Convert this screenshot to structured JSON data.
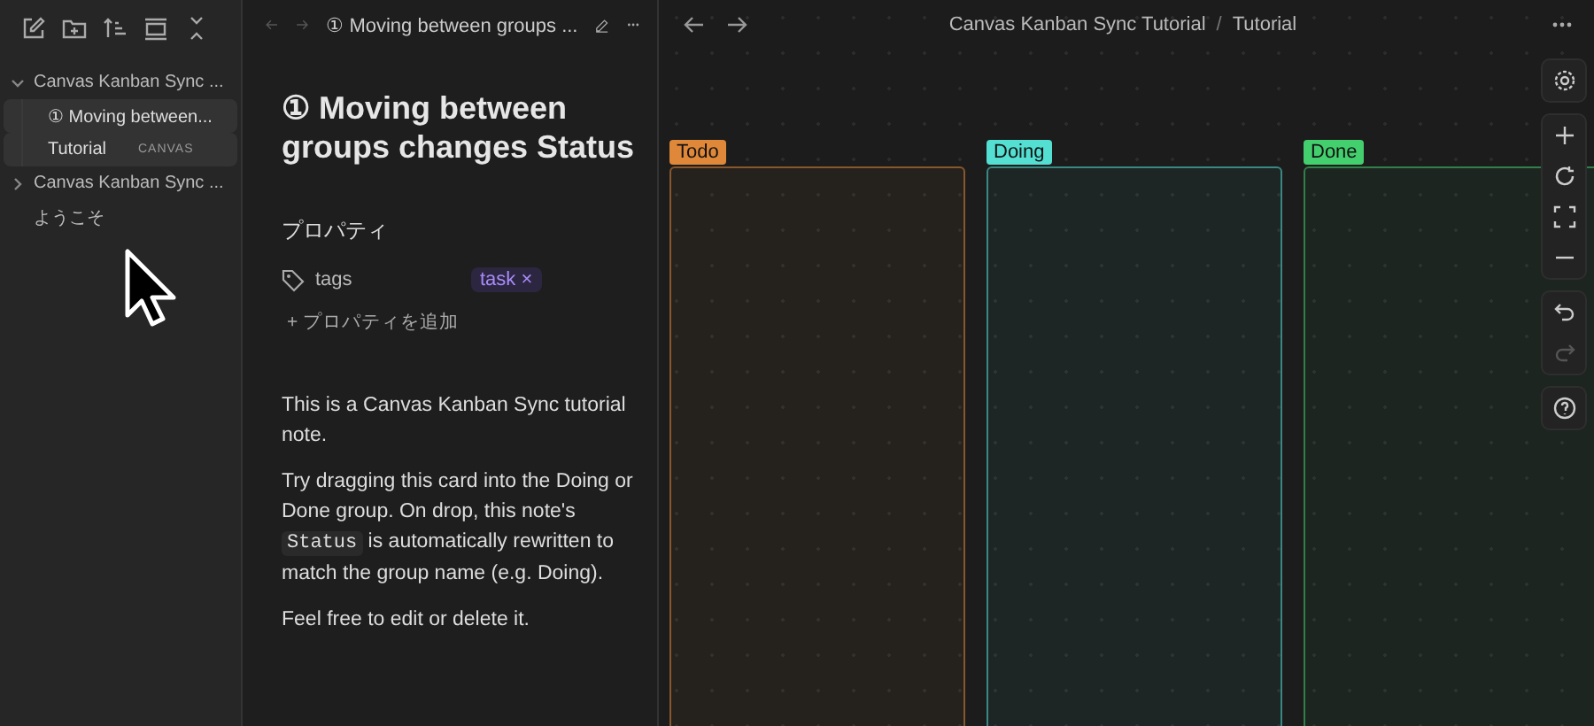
{
  "sidebar": {
    "tree": [
      {
        "label": "Canvas Kanban Sync ...",
        "expanded": true,
        "selected": false,
        "children": [
          {
            "label": "Moving between...",
            "icon": "①",
            "selected": true
          },
          {
            "label": "Tutorial",
            "badge": "CANVAS",
            "selected": true
          }
        ]
      },
      {
        "label": "Canvas Kanban Sync ...",
        "expanded": false,
        "selected": false
      },
      {
        "label": "ようこそ",
        "selected": false
      }
    ]
  },
  "note": {
    "tab_title": "① Moving between groups ...",
    "title": "① Moving between groups changes Status",
    "properties_heading": "プロパティ",
    "properties": [
      {
        "key": "tags",
        "values": [
          "task"
        ],
        "remove": "×"
      }
    ],
    "add_property": "+ プロパティを追加",
    "paragraphs": [
      [
        {
          "text": "This is a Canvas Kanban Sync tutorial note."
        }
      ],
      [
        {
          "text": "Try dragging this card into the Doing or Done group. On drop, this note's "
        },
        {
          "text": "Status",
          "code": true
        },
        {
          "text": " is automatically rewritten to match the group name (e.g. Doing)."
        }
      ],
      [
        {
          "text": "Feel free to edit or delete it."
        }
      ]
    ]
  },
  "canvas": {
    "breadcrumb": [
      "Canvas Kanban Sync Tutorial",
      "Tutorial"
    ],
    "separator": "/",
    "groups": [
      {
        "label": "Todo",
        "color": "#e0883a"
      },
      {
        "label": "Doing",
        "color": "#53dfd2"
      },
      {
        "label": "Done",
        "color": "#44cf6e"
      }
    ],
    "controls": [
      {
        "kind": "settings",
        "disabled": false
      },
      {
        "kind": "zoom-in",
        "disabled": false
      },
      {
        "kind": "reset",
        "disabled": false
      },
      {
        "kind": "fit",
        "disabled": false
      },
      {
        "kind": "zoom-out",
        "disabled": false
      },
      {
        "kind": "undo",
        "disabled": false
      },
      {
        "kind": "redo",
        "disabled": true
      },
      {
        "kind": "help",
        "disabled": false
      }
    ]
  }
}
